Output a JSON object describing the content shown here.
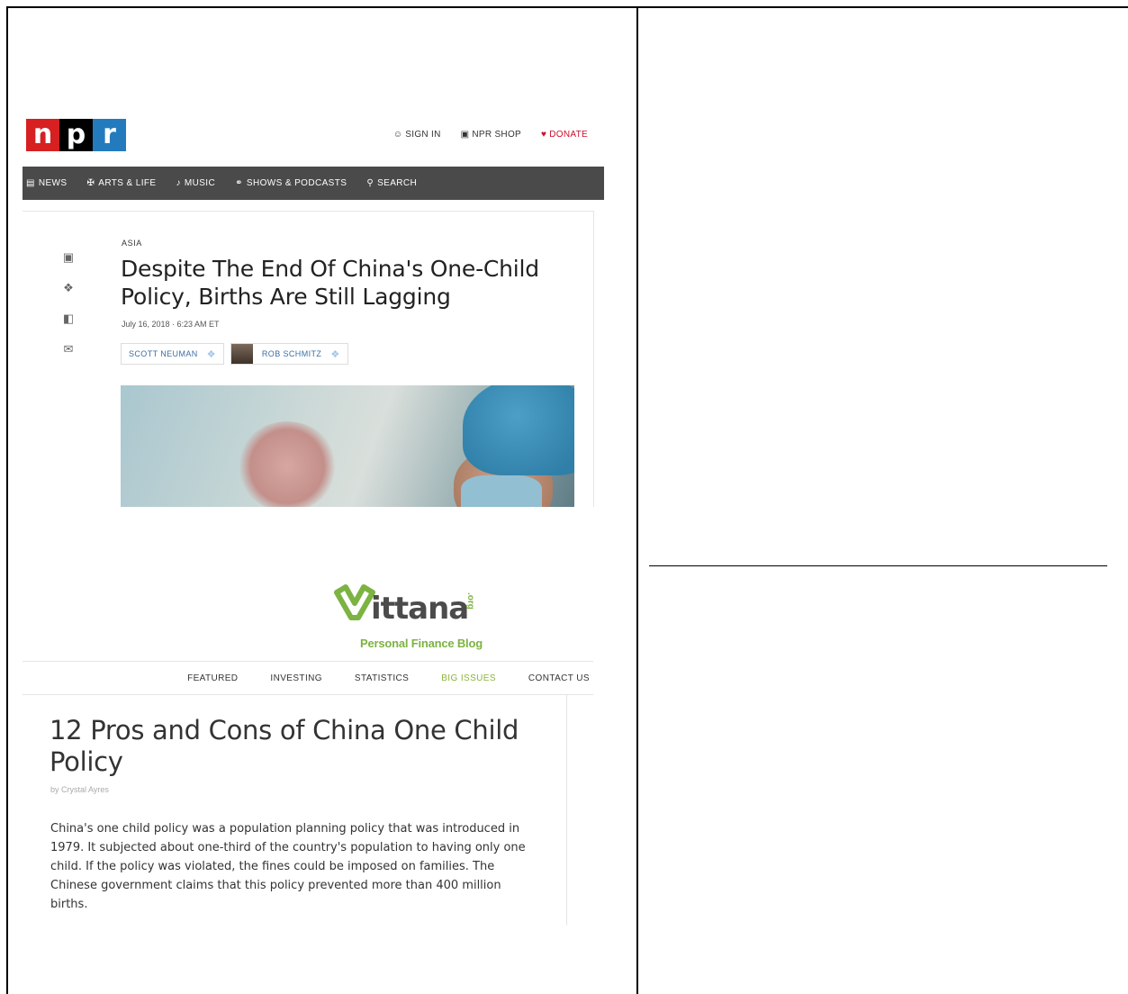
{
  "npr": {
    "logo": [
      "n",
      "p",
      "r"
    ],
    "top_links": {
      "sign_in": "SIGN IN",
      "shop": "NPR SHOP",
      "donate": "DONATE"
    },
    "nav": [
      {
        "icon": "news-icon",
        "label": "NEWS"
      },
      {
        "icon": "arts-icon",
        "label": "ARTS & LIFE"
      },
      {
        "icon": "music-icon",
        "label": "MUSIC"
      },
      {
        "icon": "headphones-icon",
        "label": "SHOWS & PODCASTS"
      },
      {
        "icon": "search-icon",
        "label": "SEARCH"
      }
    ],
    "article": {
      "slug": "ASIA",
      "headline": "Despite The End Of China's One-Child Policy, Births Are Still Lagging",
      "date": "July 16, 2018 · 6:23 AM ET",
      "bylines": [
        "SCOTT NEUMAN",
        "ROB SCHMITZ"
      ]
    },
    "colors": {
      "accent_red": "#d62021",
      "nav_bg": "#4a4a4a",
      "donate": "#c8102e"
    }
  },
  "vittana": {
    "logo_word": "ittana",
    "logo_suffix": ".org",
    "tagline": "Personal Finance Blog",
    "nav": [
      "FEATURED",
      "INVESTING",
      "STATISTICS",
      "BIG ISSUES",
      "CONTACT US"
    ],
    "active_nav": "BIG ISSUES",
    "title": "12 Pros and Cons of China One Child Policy",
    "author": "by Crystal Ayres",
    "body": "China's one child policy was a population planning policy that was introduced in 1979. It subjected about one-third of the country's population to having only one child. If the policy was violated, the fines could be imposed on families. The Chinese government claims that this policy prevented more than 400 million births.",
    "colors": {
      "brand_green": "#7cb342",
      "active_nav": "#8bb43a"
    }
  }
}
